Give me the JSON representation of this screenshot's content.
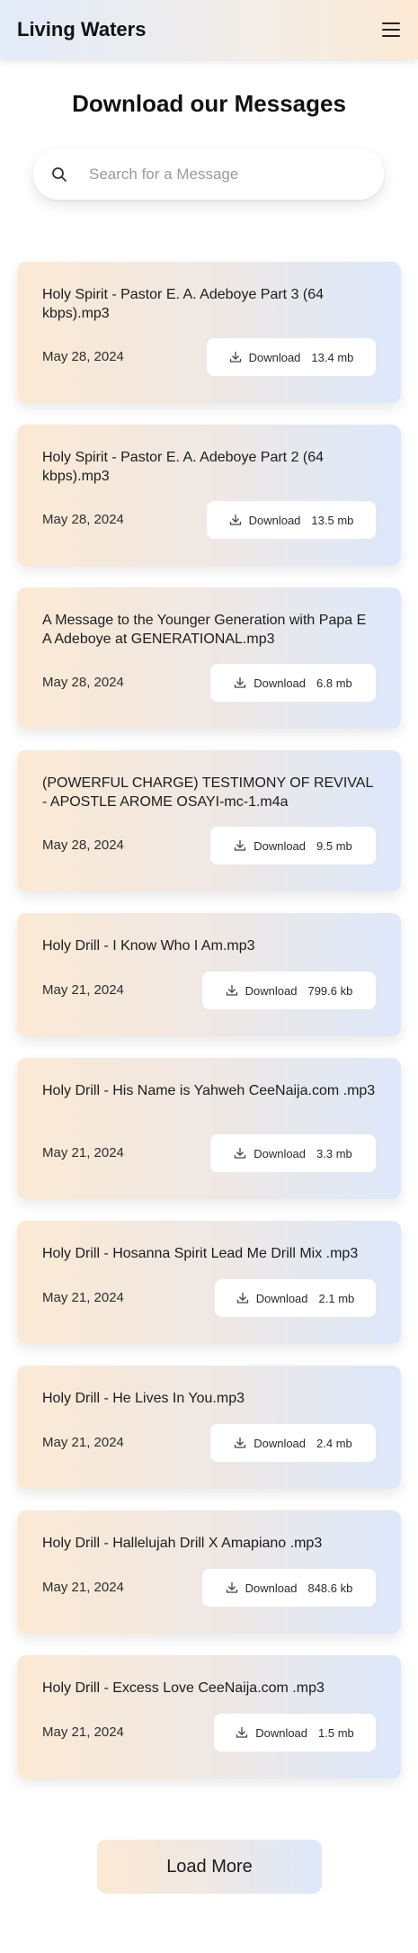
{
  "header": {
    "brand": "Living Waters",
    "menu_icon": "hamburger-menu-icon"
  },
  "page_title": "Download our Messages",
  "search": {
    "placeholder": "Search for a Message",
    "value": "",
    "icon": "search-icon"
  },
  "download_icon": "download-icon",
  "messages": [
    {
      "title": "Holy Spirit - Pastor E. A. Adeboye Part 3 (64 kbps).mp3",
      "date": "May 28, 2024",
      "button_label": "Download",
      "size": "13.4 mb"
    },
    {
      "title": "Holy Spirit - Pastor E. A. Adeboye Part 2 (64 kbps).mp3",
      "date": "May 28, 2024",
      "button_label": "Download",
      "size": "13.5 mb"
    },
    {
      "title": "A Message to the Younger Generation with Papa E A Adeboye at GENERATIONAL.mp3",
      "date": "May 28, 2024",
      "button_label": "Download",
      "size": "6.8 mb"
    },
    {
      "title": "(POWERFUL CHARGE) TESTIMONY OF REVIVAL - APOSTLE AROME OSAYI-mc-1.m4a",
      "date": "May 28, 2024",
      "button_label": "Download",
      "size": "9.5 mb"
    },
    {
      "title": "Holy Drill - I Know Who I Am.mp3",
      "date": "May 21, 2024",
      "button_label": "Download",
      "size": "799.6 kb"
    },
    {
      "title": "Holy Drill - His Name is Yahweh CeeNaija.com .mp3",
      "date": "May 21, 2024",
      "button_label": "Download",
      "size": "3.3 mb"
    },
    {
      "title": "Holy Drill - Hosanna Spirit Lead Me Drill Mix .mp3",
      "date": "May 21, 2024",
      "button_label": "Download",
      "size": "2.1 mb"
    },
    {
      "title": "Holy Drill - He Lives In You.mp3",
      "date": "May 21, 2024",
      "button_label": "Download",
      "size": "2.4 mb"
    },
    {
      "title": "Holy Drill - Hallelujah Drill X Amapiano .mp3",
      "date": "May 21, 2024",
      "button_label": "Download",
      "size": "848.6 kb"
    },
    {
      "title": "Holy Drill - Excess Love CeeNaija.com .mp3",
      "date": "May 21, 2024",
      "button_label": "Download",
      "size": "1.5 mb"
    }
  ],
  "load_more_label": "Load More"
}
